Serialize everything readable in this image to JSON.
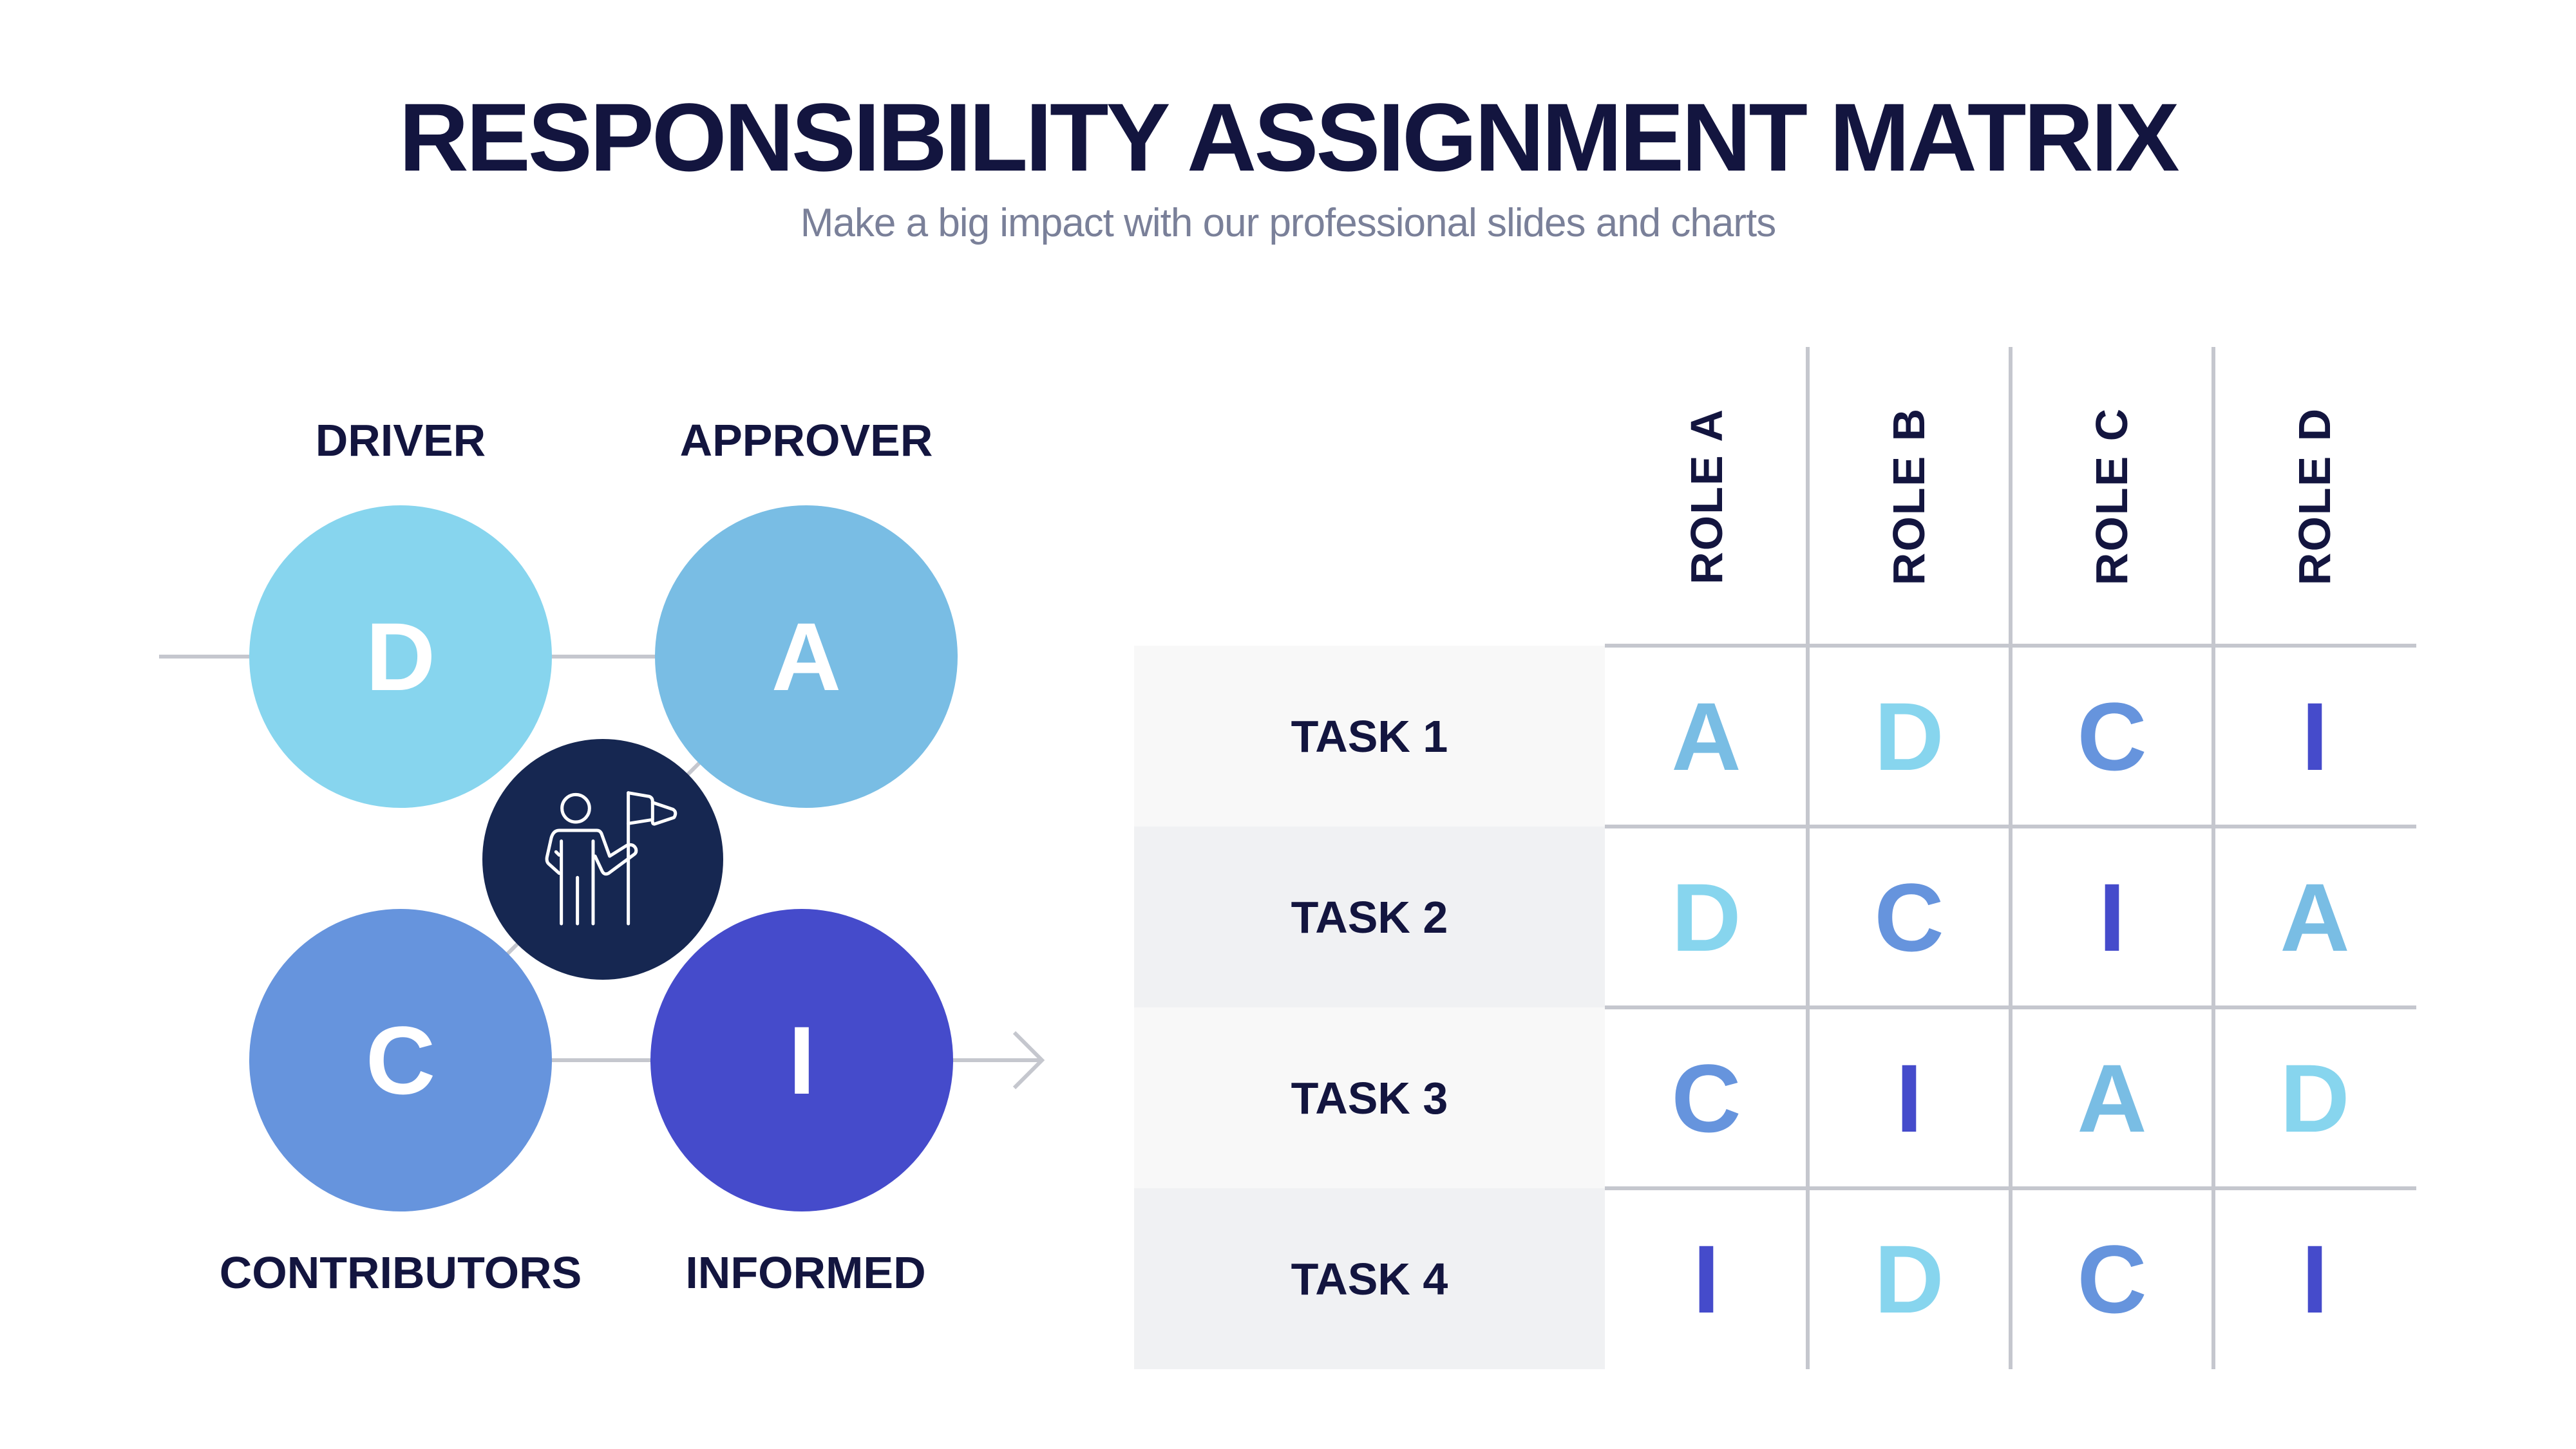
{
  "header": {
    "title": "RESPONSIBILITY ASSIGNMENT MATRIX",
    "subtitle": "Make a big impact with our professional slides and charts"
  },
  "colors": {
    "D": "#87D5EE",
    "A": "#79BDE4",
    "C": "#6694DD",
    "I": "#454BCB",
    "center": "#162751",
    "text_dark": "#13153F",
    "subtitle": "#7A8099",
    "line": "#C5C7CE",
    "task_row_odd": "#F8F8F8",
    "task_row_even": "#F0F1F3"
  },
  "legend": {
    "items": [
      {
        "letter": "D",
        "label": "DRIVER"
      },
      {
        "letter": "A",
        "label": "APPROVER"
      },
      {
        "letter": "C",
        "label": "CONTRIBUTORS"
      },
      {
        "letter": "I",
        "label": "INFORMED"
      }
    ],
    "center_icon": "person-with-flag-icon"
  },
  "matrix": {
    "roles": [
      "ROLE A",
      "ROLE B",
      "ROLE C",
      "ROLE D"
    ],
    "tasks": [
      {
        "label": "TASK 1",
        "cells": [
          "A",
          "D",
          "C",
          "I"
        ]
      },
      {
        "label": "TASK 2",
        "cells": [
          "D",
          "C",
          "I",
          "A"
        ]
      },
      {
        "label": "TASK 3",
        "cells": [
          "C",
          "I",
          "A",
          "D"
        ]
      },
      {
        "label": "TASK 4",
        "cells": [
          "I",
          "D",
          "C",
          "I"
        ]
      }
    ]
  }
}
